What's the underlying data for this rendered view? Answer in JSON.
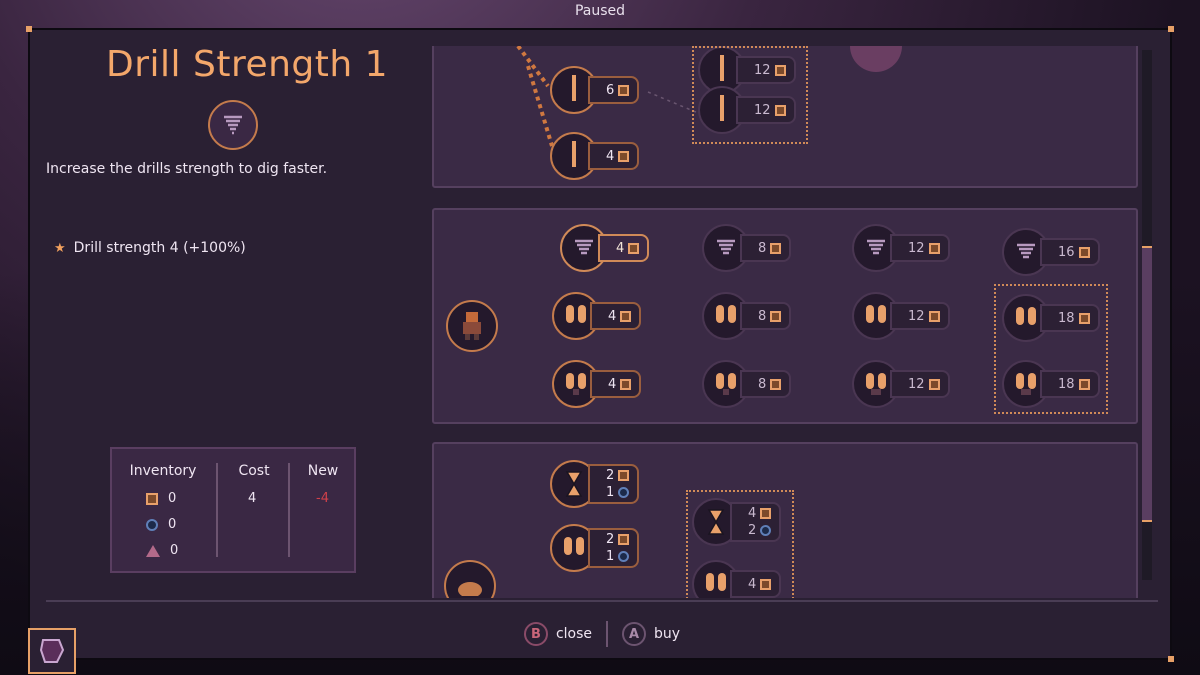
{
  "header": {
    "status": "Paused"
  },
  "upgrade": {
    "title": "Drill Strength 1",
    "icon": "drill-tornado-icon",
    "description": "Increase the drills strength to dig faster.",
    "effect": "Drill strength 4 (+100%)"
  },
  "inventory": {
    "headers": {
      "inventory": "Inventory",
      "cost": "Cost",
      "new": "New"
    },
    "rows": [
      {
        "icon": "iron-resource-icon",
        "have": "0"
      },
      {
        "icon": "water-resource-icon",
        "have": "0"
      },
      {
        "icon": "cobalt-resource-icon",
        "have": "0"
      }
    ],
    "cost": "4",
    "new": "-4",
    "new_color": "#d0404a"
  },
  "tree": {
    "top_panel": [
      {
        "cost": "6"
      },
      {
        "cost": "4"
      },
      {
        "cost": "12"
      },
      {
        "cost": "12"
      }
    ],
    "middle_panel": {
      "drill_row": [
        "4",
        "8",
        "12",
        "16"
      ],
      "jetpack_row": [
        "4",
        "8",
        "12",
        "18"
      ],
      "carry_row": [
        "4",
        "8",
        "12",
        "18"
      ]
    },
    "bottom_panel": [
      {
        "iron": "2",
        "water": "1"
      },
      {
        "iron": "2",
        "water": "1"
      },
      {
        "iron": "4",
        "water": "2"
      },
      {
        "iron": "4"
      }
    ]
  },
  "footer": {
    "close_glyph": "B",
    "close_label": "close",
    "buy_glyph": "A",
    "buy_label": "buy"
  },
  "colors": {
    "accent": "#f3a76b",
    "panel": "#3a2a45",
    "window": "#2a2033"
  }
}
